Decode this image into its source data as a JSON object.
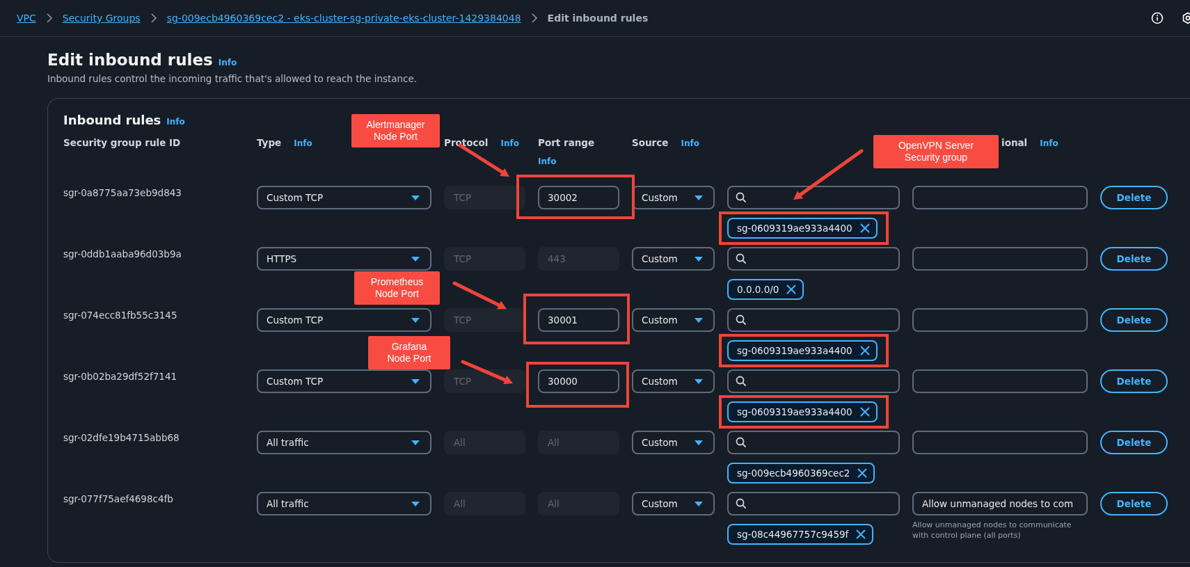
{
  "breadcrumb": [
    {
      "label": "VPC",
      "link": true
    },
    {
      "label": "Security Groups",
      "link": true
    },
    {
      "label": "sg-009ecb4960369cec2 - eks-cluster-sg-private-eks-cluster-1429384048",
      "link": true
    },
    {
      "label": "Edit inbound rules",
      "link": false
    }
  ],
  "page": {
    "title": "Edit inbound rules",
    "title_info": "Info",
    "description": "Inbound rules control the incoming traffic that's allowed to reach the instance."
  },
  "inbound_rules": {
    "title": "Inbound rules",
    "title_info": "Info",
    "columns": [
      {
        "label": "Security group rule ID"
      },
      {
        "label": "Type",
        "info": "Info"
      },
      {
        "label": "Protocol",
        "info": "Info"
      },
      {
        "label": "Port range",
        "info": "Info"
      },
      {
        "label": "Source",
        "info": "Info"
      }
    ],
    "column_7": {
      "label": "ional",
      "info": "Info"
    },
    "rows": [
      {
        "rule_id": "sgr-0a8775aa73eb9d843",
        "type": "Custom TCP",
        "protocol": "TCP",
        "port_range": "30002",
        "port_editable": true,
        "source": "Custom",
        "tokens": [
          "sg-0609319ae933a4400"
        ],
        "delete": "Delete",
        "port_highlighted": true,
        "port_callout": "Alertmanager Node Port",
        "token_highlighted": true,
        "source_callout": "OpenVPN Server Security group"
      },
      {
        "rule_id": "sgr-0ddb1aaba96d03b9a",
        "type": "HTTPS",
        "protocol": "TCP",
        "port_range": "443",
        "port_editable": false,
        "source": "Custom",
        "tokens": [
          "0.0.0.0/0"
        ],
        "delete": "Delete",
        "port_highlighted": false,
        "token_highlighted": false
      },
      {
        "rule_id": "sgr-074ecc81fb55c3145",
        "type": "Custom TCP",
        "protocol": "TCP",
        "port_range": "30001",
        "port_editable": true,
        "source": "Custom",
        "tokens": [
          "sg-0609319ae933a4400"
        ],
        "delete": "Delete",
        "port_highlighted": true,
        "port_callout": "Prometheus Node Port",
        "token_highlighted": true
      },
      {
        "rule_id": "sgr-0b02ba29df52f7141",
        "type": "Custom TCP",
        "protocol": "TCP",
        "port_range": "30000",
        "port_editable": true,
        "source": "Custom",
        "tokens": [
          "sg-0609319ae933a4400"
        ],
        "delete": "Delete",
        "port_highlighted": true,
        "port_callout": "Grafana Node Port",
        "token_highlighted": true
      },
      {
        "rule_id": "sgr-02dfe19b4715abb68",
        "type": "All traffic",
        "protocol": "All",
        "port_range": "All",
        "port_editable": false,
        "source": "Custom",
        "tokens": [
          "sg-009ecb4960369cec2"
        ],
        "delete": "Delete",
        "port_highlighted": false,
        "token_highlighted": false
      },
      {
        "rule_id": "sgr-077f75aef4698c4fb",
        "type": "All traffic",
        "protocol": "All",
        "port_range": "All",
        "port_editable": false,
        "source": "Custom",
        "tokens": [
          "sg-08c44967757c9459f"
        ],
        "description": "Allow unmanaged nodes to com",
        "description_hint": "Allow unmanaged nodes to communicate with control plane (all ports)",
        "delete": "Delete",
        "port_highlighted": false,
        "token_highlighted": false
      }
    ]
  }
}
